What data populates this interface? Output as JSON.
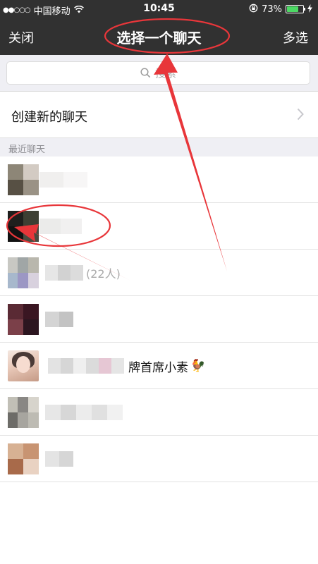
{
  "status_bar": {
    "signal": "●●○○○",
    "carrier": "中国移动",
    "wifi": "wifi-icon",
    "time": "10:45",
    "lock": "orientation-lock-icon",
    "battery_percent": "73%",
    "battery_level": 0.73,
    "battery_color": "#4cd964",
    "charging": "bolt-icon"
  },
  "nav": {
    "close_label": "关闭",
    "title": "选择一个聊天",
    "multi_select_label": "多选",
    "background": "#313131"
  },
  "search": {
    "placeholder": "搜索",
    "icon": "search-icon"
  },
  "new_chat": {
    "label": "创建新的聊天",
    "icon": "chevron-right-icon"
  },
  "recent_section": {
    "title": "最近聊天"
  },
  "chats": [
    {
      "name_suffix": "",
      "name_visible": ""
    },
    {
      "name_suffix": "",
      "name_visible": ""
    },
    {
      "name_suffix": "(22人)",
      "name_visible": ""
    },
    {
      "name_suffix": "",
      "name_visible": ""
    },
    {
      "name_suffix": "",
      "name_visible": "牌首席小素",
      "emoji": "🐓"
    },
    {
      "name_suffix": "",
      "name_visible": ""
    },
    {
      "name_suffix": "",
      "name_visible": ""
    }
  ],
  "annotation_color": "#e8363a"
}
